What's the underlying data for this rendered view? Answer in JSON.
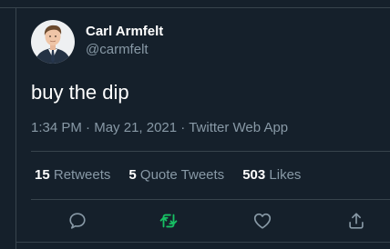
{
  "tweet": {
    "author": {
      "display_name": "Carl Armfelt",
      "handle": "@carmfelt",
      "avatar_icon": "profile-photo"
    },
    "text": "buy the dip",
    "meta": {
      "time": "1:34 PM",
      "date": "May 21, 2021",
      "source": "Twitter Web App",
      "separator": "·"
    },
    "stats": {
      "retweets": {
        "count": "15",
        "label": "Retweets"
      },
      "quote_tweets": {
        "count": "5",
        "label": "Quote Tweets"
      },
      "likes": {
        "count": "503",
        "label": "Likes"
      }
    },
    "actions": [
      {
        "name": "reply",
        "icon": "reply-icon"
      },
      {
        "name": "retweet",
        "icon": "retweet-icon"
      },
      {
        "name": "like",
        "icon": "heart-icon"
      },
      {
        "name": "share",
        "icon": "share-icon"
      }
    ]
  },
  "colors": {
    "background": "#15202b",
    "text_primary": "#ffffff",
    "text_secondary": "#8899a6",
    "divider": "#38444d",
    "retweet_active": "#17bf63"
  }
}
